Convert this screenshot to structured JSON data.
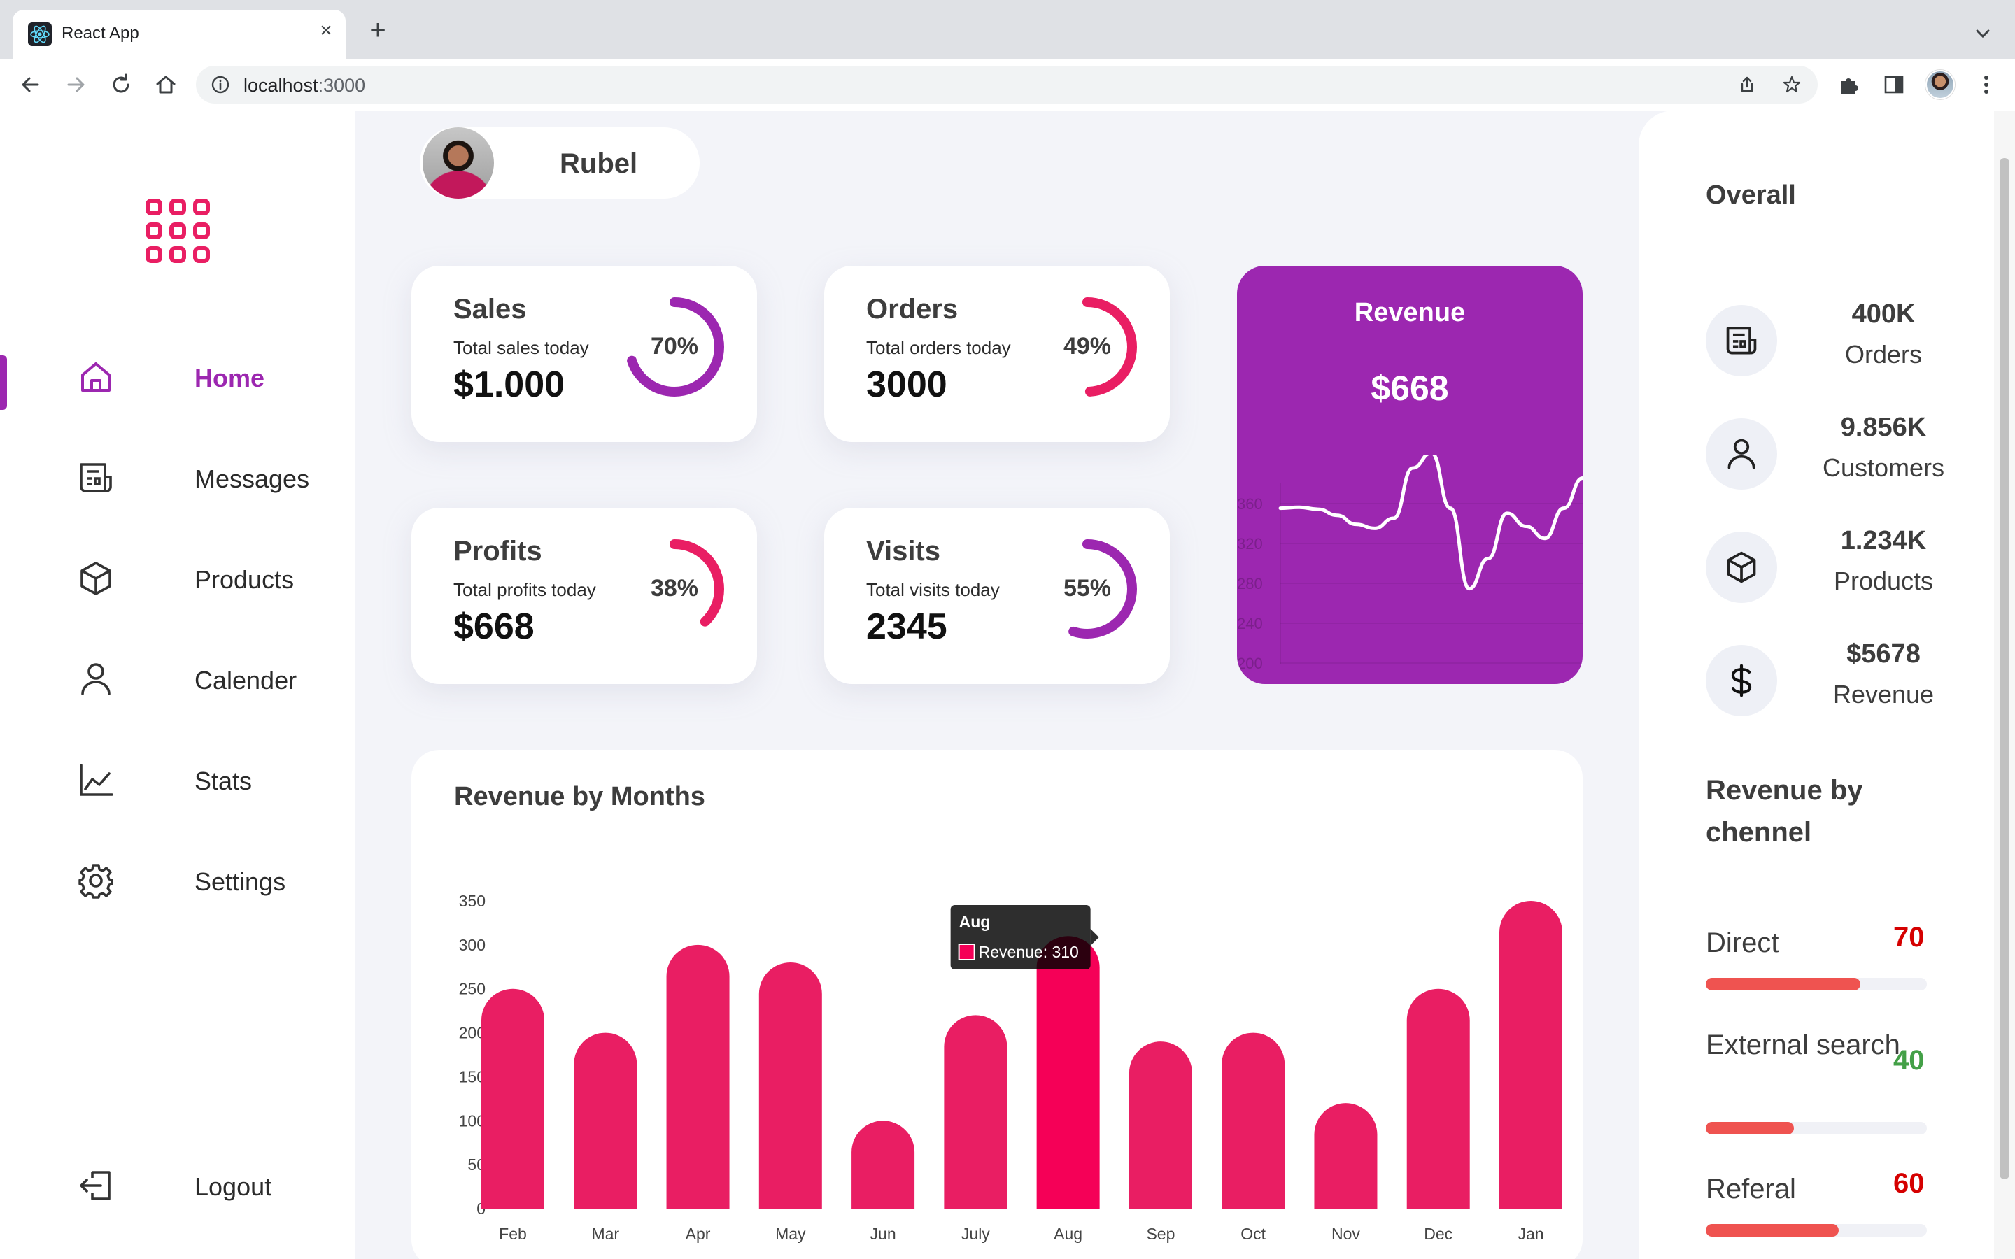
{
  "browser": {
    "tab_title": "React App",
    "tab_close": "×",
    "new_tab": "+",
    "url_host": "localhost",
    "url_port": ":3000"
  },
  "sidebar": {
    "items": [
      {
        "label": "Home",
        "icon": "home-icon",
        "active": true
      },
      {
        "label": "Messages",
        "icon": "messages-icon"
      },
      {
        "label": "Products",
        "icon": "box-icon"
      },
      {
        "label": "Calender",
        "icon": "user-icon"
      },
      {
        "label": "Stats",
        "icon": "chart-line-icon"
      },
      {
        "label": "Settings",
        "icon": "gear-icon"
      }
    ],
    "logout": {
      "label": "Logout",
      "icon": "logout-icon"
    }
  },
  "profile": {
    "name": "Rubel"
  },
  "cards": {
    "sales": {
      "title": "Sales",
      "subtitle": "Total sales today",
      "value": "$1.000",
      "percent_label": "70%",
      "percent": 70,
      "color": "#9c27b0"
    },
    "orders": {
      "title": "Orders",
      "subtitle": "Total orders today",
      "value": "3000",
      "percent_label": "49%",
      "percent": 49,
      "color": "#e91e63"
    },
    "profits": {
      "title": "Profits",
      "subtitle": "Total profits today",
      "value": "$668",
      "percent_label": "38%",
      "percent": 38,
      "color": "#e91e63"
    },
    "visits": {
      "title": "Visits",
      "subtitle": "Total visits today",
      "value": "2345",
      "percent_label": "55%",
      "percent": 55,
      "color": "#9c27b0"
    }
  },
  "revenue": {
    "title": "Revenue",
    "value": "$668",
    "spark": {
      "y_ticks": [
        "360",
        "320",
        "280",
        "240",
        "200"
      ],
      "ylim": [
        200,
        360
      ],
      "values": [
        290,
        291,
        289,
        283,
        274,
        270,
        280,
        330,
        345,
        290,
        210,
        240,
        285,
        272,
        260,
        290,
        320
      ]
    }
  },
  "chart_data": {
    "type": "bar",
    "title": "Revenue by Months",
    "categories": [
      "Feb",
      "Mar",
      "Apr",
      "May",
      "Jun",
      "July",
      "Aug",
      "Sep",
      "Oct",
      "Nov",
      "Dec",
      "Jan"
    ],
    "series": [
      {
        "name": "Revenue",
        "values": [
          250,
          200,
          300,
          280,
          100,
          220,
          310,
          190,
          200,
          120,
          250,
          350
        ]
      }
    ],
    "ylim": [
      0,
      350
    ],
    "y_ticks": [
      0,
      50,
      100,
      150,
      200,
      250,
      300,
      350
    ],
    "highlight_index": 6,
    "bar_color": "#e91e63",
    "highlight_color": "#f50057",
    "tooltip": {
      "title": "Aug",
      "label": "Revenue: 310"
    }
  },
  "overall": {
    "title": "Overall",
    "stats": [
      {
        "value": "400K",
        "label": "Orders",
        "icon": "messages-icon"
      },
      {
        "value": "9.856K",
        "label": "Customers",
        "icon": "user-icon"
      },
      {
        "value": "1.234K",
        "label": "Products",
        "icon": "box-icon"
      },
      {
        "value": "$5678",
        "label": "Revenue",
        "icon": "dollar-icon"
      }
    ]
  },
  "channels": {
    "title": "Revenue by chennel",
    "items": [
      {
        "name": "Direct",
        "value": "70",
        "fraction": 0.7,
        "color": "#d50000"
      },
      {
        "name": "External search",
        "value": "40",
        "fraction": 0.4,
        "color": "#43a047"
      },
      {
        "name": "Referal",
        "value": "60",
        "fraction": 0.6,
        "color": "#d50000"
      }
    ]
  }
}
